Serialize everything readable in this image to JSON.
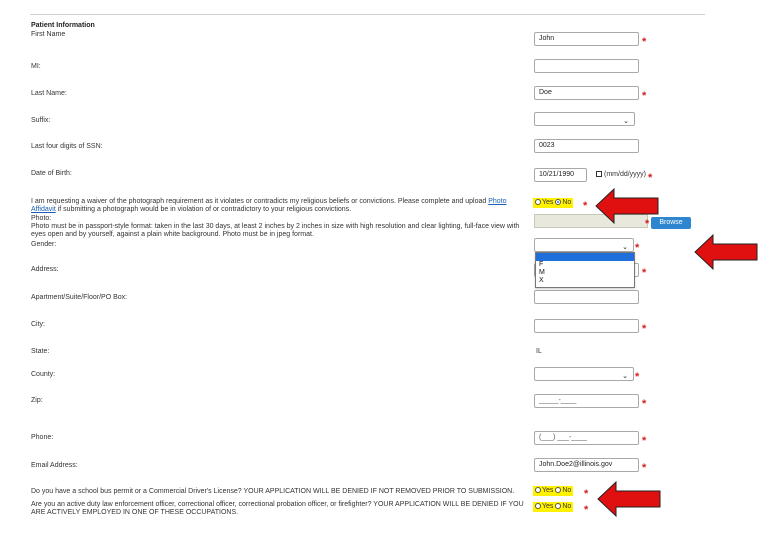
{
  "section_title": "Patient Information",
  "fields": {
    "first_name": {
      "label": "First Name",
      "value": "John"
    },
    "mi": {
      "label": "MI:",
      "value": ""
    },
    "last_name": {
      "label": "Last Name:",
      "value": "Doe"
    },
    "suffix": {
      "label": "Suffix:",
      "value": ""
    },
    "ssn": {
      "label": "Last four digits of SSN:",
      "value": "0023"
    },
    "dob": {
      "label": "Date of Birth:",
      "value": "10/21/1990",
      "hint": "(mm/dd/yyyy)"
    },
    "waiver": {
      "text_before": "I am requesting a waiver of the photograph requirement as it violates or contradicts my religious beliefs or convictions. Please complete and upload ",
      "link": "Photo Affidavit",
      "text_after": " if submitting a photograph would be in violation of or contradictory to your religious convictions.",
      "yes": "Yes",
      "no": "No",
      "selected": "No"
    },
    "photo": {
      "label": "Photo:",
      "description": "Photo must be in passport-style format: taken in the last 30 days, at least 2 inches by 2 inches in size with high resolution and clear lighting, full-face view with eyes open and by yourself, against a plain white background. Photo must be in jpeg format.",
      "browse": "Browse"
    },
    "gender": {
      "label": "Gender:",
      "value": "",
      "options": [
        "",
        "F",
        "M",
        "X"
      ]
    },
    "address": {
      "label": "Address:",
      "value": ""
    },
    "apartment": {
      "label": "Apartment/Suite/Floor/PO Box:",
      "value": ""
    },
    "city": {
      "label": "City:",
      "value": ""
    },
    "state": {
      "label": "State:",
      "value": "IL"
    },
    "county": {
      "label": "County:",
      "value": ""
    },
    "zip": {
      "label": "Zip:",
      "placeholder": "_____-____"
    },
    "phone": {
      "label": "Phone:",
      "placeholder": "(___) ___-____"
    },
    "email": {
      "label": "Email Address:",
      "value": "John.Doe2@illinois.gov"
    },
    "bus_permit": {
      "question": "Do you have a school bus permit or a Commercial Driver's License? YOUR APPLICATION WILL BE DENIED IF NOT REMOVED PRIOR TO SUBMISSION.",
      "yes": "Yes",
      "no": "No"
    },
    "law_enforcement": {
      "question": "Are you an active duty law enforcement officer, correctional officer, correctional probation officer, or firefighter? YOUR APPLICATION WILL BE DENIED IF YOU ARE ACTIVELY EMPLOYED IN ONE OF THESE OCCUPATIONS.",
      "yes": "Yes",
      "no": "No"
    }
  },
  "required_marker": "*",
  "colors": {
    "highlight": "#fff200",
    "arrow": "#e01010",
    "browse": "#2f86d0",
    "required": "#d21f1f"
  }
}
